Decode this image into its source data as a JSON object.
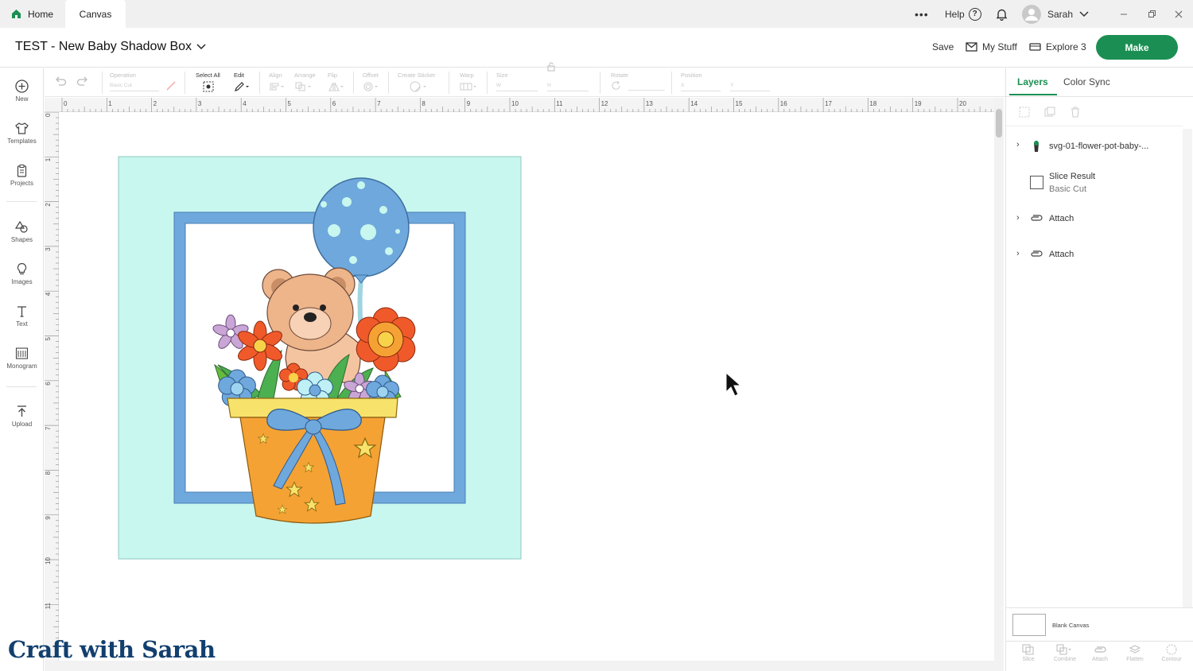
{
  "tabs": {
    "home": "Home",
    "canvas": "Canvas"
  },
  "titlebar": {
    "more": "•••",
    "help": "Help",
    "user": "Sarah"
  },
  "project": {
    "title": "TEST - New Baby Shadow Box"
  },
  "header": {
    "save": "Save",
    "my_stuff": "My Stuff",
    "machine": "Explore 3",
    "make": "Make"
  },
  "toolbar": {
    "operation_label": "Operation",
    "operation_value": "Basic Cut",
    "select_all": "Select All",
    "edit": "Edit",
    "align": "Align",
    "arrange": "Arrange",
    "flip": "Flip",
    "offset": "Offset",
    "create_sticker": "Create Sticker",
    "warp": "Warp",
    "size": "Size",
    "w": "W",
    "h": "H",
    "rotate": "Rotate",
    "position": "Position",
    "x": "X",
    "y": "Y"
  },
  "sidebar": {
    "items": [
      "New",
      "Templates",
      "Projects",
      "Shapes",
      "Images",
      "Text",
      "Monogram",
      "Upload"
    ]
  },
  "ruler": {
    "top": [
      "0",
      "1",
      "2",
      "3",
      "4",
      "5",
      "6",
      "7",
      "8",
      "9",
      "10",
      "11",
      "12",
      "13",
      "14",
      "15",
      "16",
      "17",
      "18",
      "19",
      "20"
    ],
    "left": [
      "0",
      "1",
      "2",
      "3",
      "4",
      "5",
      "6",
      "7",
      "8",
      "9",
      "10",
      "11"
    ]
  },
  "panel": {
    "tabs": {
      "layers": "Layers",
      "color_sync": "Color Sync"
    },
    "layers": [
      {
        "name": "svg-01-flower-pot-baby-...",
        "sub": ""
      },
      {
        "name": "Slice Result",
        "sub": "Basic Cut"
      },
      {
        "name": "Attach",
        "sub": ""
      },
      {
        "name": "Attach",
        "sub": ""
      }
    ],
    "blank_canvas": "Blank Canvas",
    "bottom_tools": [
      "Slice",
      "Combine",
      "Attach",
      "Flatten",
      "Contour"
    ]
  },
  "colors": {
    "accent": "#1b8f53",
    "mint": "#c8f7ef",
    "frame": "#6fa8dc"
  },
  "watermark": "Craft with Sarah"
}
